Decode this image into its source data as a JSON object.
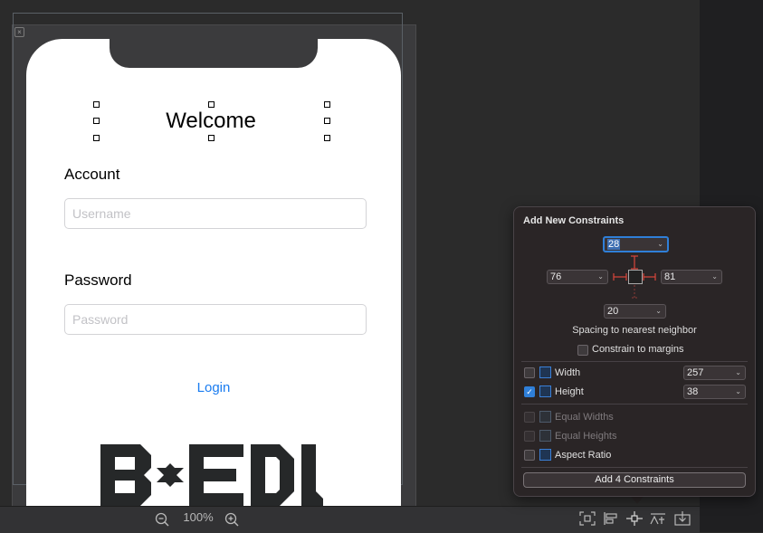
{
  "canvas": {
    "welcome_title": "Welcome",
    "account_label": "Account",
    "username_placeholder": "Username",
    "password_label": "Password",
    "password_placeholder": "Password",
    "login_button": "Login",
    "logo_text": "BEDU"
  },
  "bottom_bar": {
    "zoom_level": "100%"
  },
  "constraints_popover": {
    "title": "Add New Constraints",
    "top_value": "28",
    "left_value": "76",
    "right_value": "81",
    "bottom_value": "20",
    "spacing_label": "Spacing to nearest neighbor",
    "constrain_margins_label": "Constrain to margins",
    "width": {
      "label": "Width",
      "value": "257",
      "checked": false
    },
    "height": {
      "label": "Height",
      "value": "38",
      "checked": true
    },
    "equal_widths_label": "Equal Widths",
    "equal_heights_label": "Equal Heights",
    "aspect_ratio_label": "Aspect Ratio",
    "add_button": "Add 4 Constraints"
  },
  "colors": {
    "accent": "#2f7fd8",
    "link_blue": "#1a7cf0",
    "constraint_red": "#d9453b"
  }
}
